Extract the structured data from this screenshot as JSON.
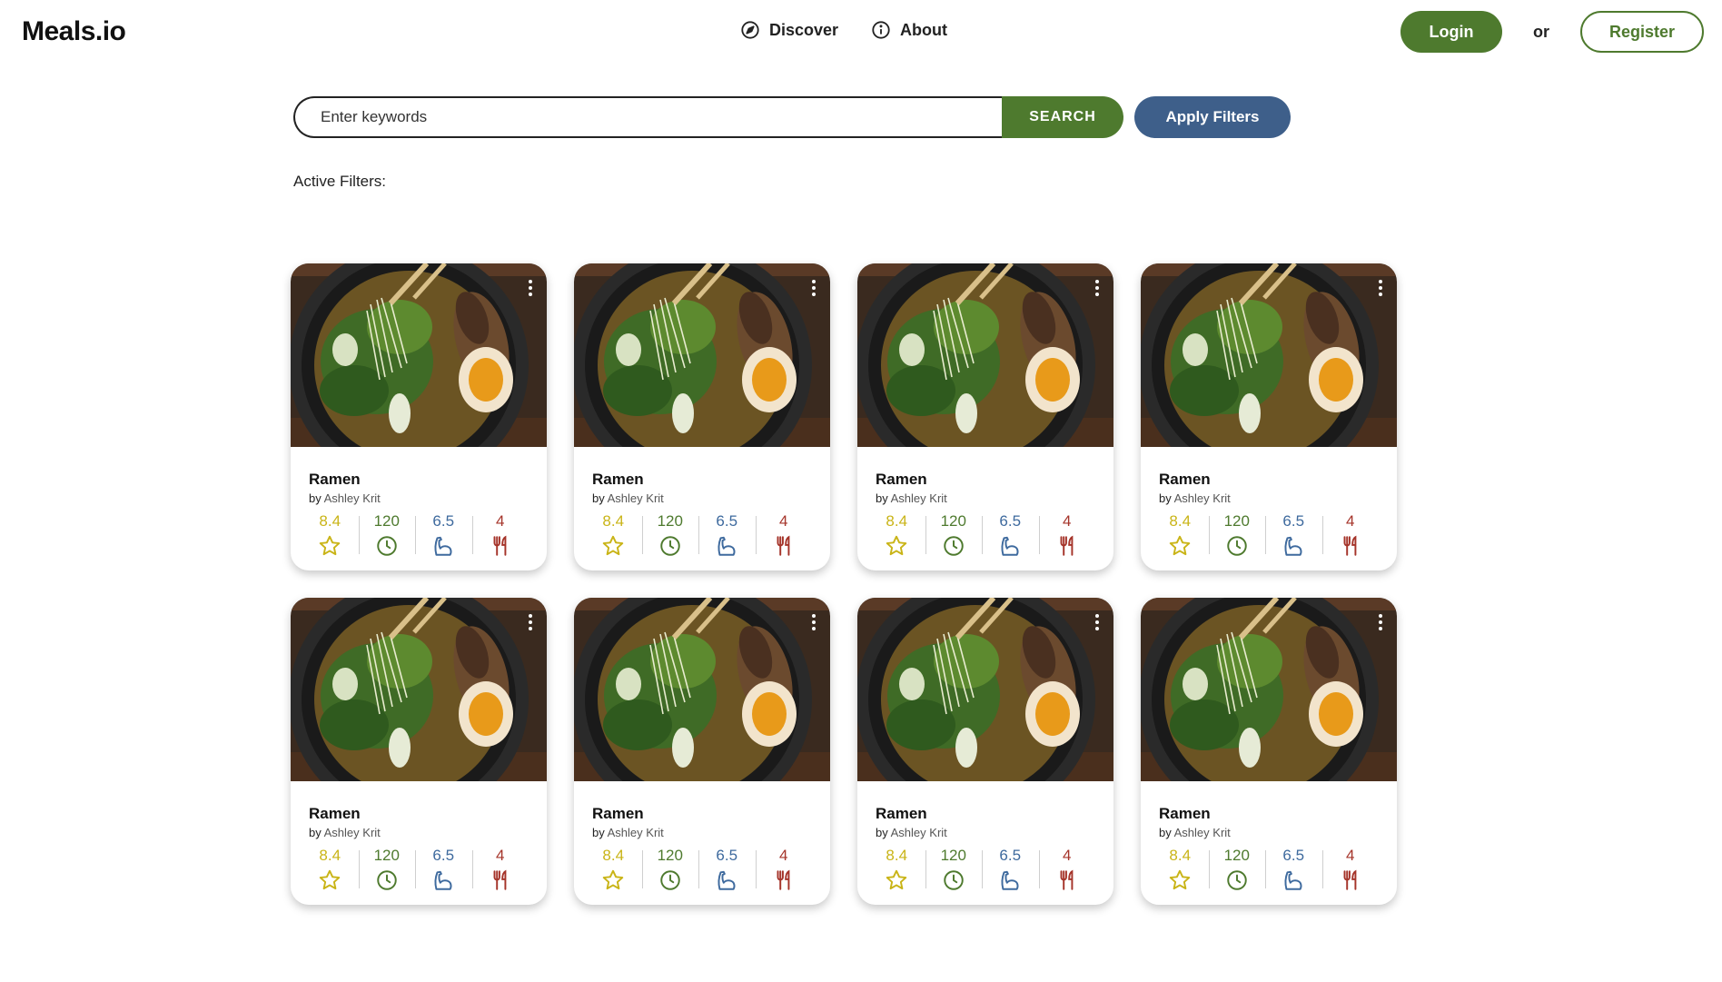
{
  "header": {
    "logo": "Meals.io",
    "nav": [
      {
        "label": "Discover",
        "icon": "compass-icon"
      },
      {
        "label": "About",
        "icon": "info-icon"
      }
    ],
    "login_label": "Login",
    "or_label": "or",
    "register_label": "Register"
  },
  "search": {
    "placeholder": "Enter keywords",
    "button_label": "SEARCH",
    "filters_label": "Apply Filters"
  },
  "filters": {
    "label": "Active Filters:"
  },
  "colors": {
    "brand_green": "#4e7a2e",
    "filter_blue": "#3e5f8a",
    "rating": "#c9b417",
    "time": "#4e7a2e",
    "difficulty": "#3e6a9e",
    "servings": "#a5342a"
  },
  "recipes": [
    {
      "title": "Ramen",
      "by": "by",
      "author": "Ashley Krit",
      "rating": "8.4",
      "time": "120",
      "difficulty": "6.5",
      "servings": "4"
    },
    {
      "title": "Ramen",
      "by": "by",
      "author": "Ashley Krit",
      "rating": "8.4",
      "time": "120",
      "difficulty": "6.5",
      "servings": "4"
    },
    {
      "title": "Ramen",
      "by": "by",
      "author": "Ashley Krit",
      "rating": "8.4",
      "time": "120",
      "difficulty": "6.5",
      "servings": "4"
    },
    {
      "title": "Ramen",
      "by": "by",
      "author": "Ashley Krit",
      "rating": "8.4",
      "time": "120",
      "difficulty": "6.5",
      "servings": "4"
    },
    {
      "title": "Ramen",
      "by": "by",
      "author": "Ashley Krit",
      "rating": "8.4",
      "time": "120",
      "difficulty": "6.5",
      "servings": "4"
    },
    {
      "title": "Ramen",
      "by": "by",
      "author": "Ashley Krit",
      "rating": "8.4",
      "time": "120",
      "difficulty": "6.5",
      "servings": "4"
    },
    {
      "title": "Ramen",
      "by": "by",
      "author": "Ashley Krit",
      "rating": "8.4",
      "time": "120",
      "difficulty": "6.5",
      "servings": "4"
    },
    {
      "title": "Ramen",
      "by": "by",
      "author": "Ashley Krit",
      "rating": "8.4",
      "time": "120",
      "difficulty": "6.5",
      "servings": "4"
    }
  ]
}
